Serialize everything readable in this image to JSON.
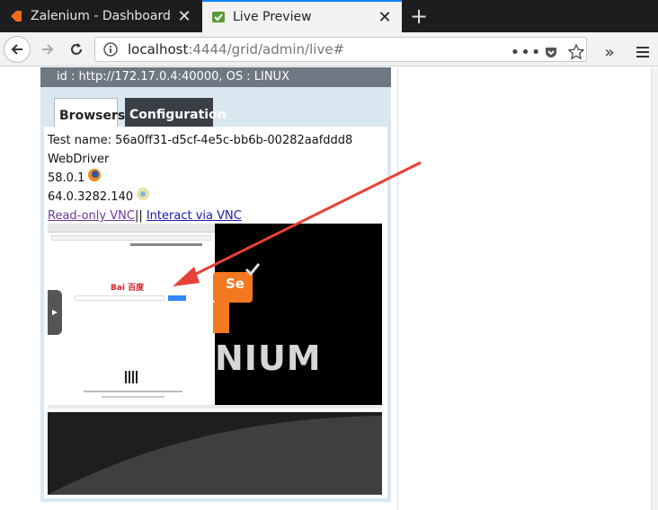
{
  "tabs": [
    {
      "label": "Zalenium - Dashboard",
      "active": false
    },
    {
      "label": "Live Preview",
      "active": true
    }
  ],
  "nav": {
    "url_host": "localhost",
    "url_rest": ":4444/grid/admin/live#",
    "icons": [
      "back-icon",
      "forward-icon",
      "reload-icon",
      "info-icon",
      "more-icon",
      "pocket-icon",
      "star-icon",
      "overflow-icon",
      "menu-icon"
    ]
  },
  "panel": {
    "header": "id : http://172.17.0.4:40000, OS : LINUX",
    "tab_browsers": "Browsers",
    "tab_configuration": "Configuration",
    "test_name": "Test name: 56a0ff31-d5cf-4e5c-bb6b-00282aafddd8",
    "driver": "WebDriver",
    "firefox_version": "58.0.1",
    "chrome_version": "64.0.3282.140",
    "readonly_vnc": "Read-only VNC",
    "separator": "||",
    "interact_vnc": "Interact via VNC",
    "se_badge": "Se",
    "zalenium_text": "NIUM",
    "baidu_logo": "Bai 百度"
  },
  "colors": {
    "accent": "#0a84ff",
    "annotation_arrow": "#e8403a",
    "panel_header": "#6e7882"
  }
}
